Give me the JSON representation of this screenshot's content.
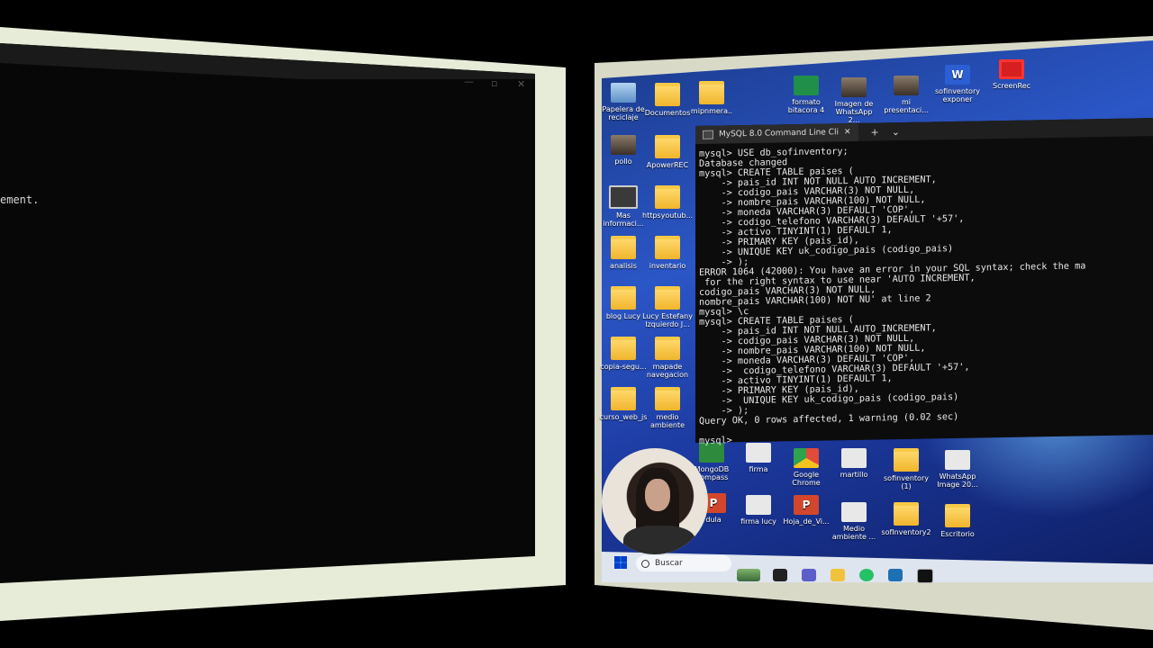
{
  "left_window": {
    "visible_text": "ement."
  },
  "desktop": {
    "icons": [
      {
        "label": "Papelera de reciclaje",
        "type": "bin"
      },
      {
        "label": "Documentos",
        "type": "folder"
      },
      {
        "label": "mipnmera..",
        "type": "folder"
      },
      {
        "label": "formato bitacora 4",
        "type": "sheet"
      },
      {
        "label": "Imagen de WhatsApp 2...",
        "type": "photo"
      },
      {
        "label": "mi presentaci...",
        "type": "photo"
      },
      {
        "label": "sofinventory exponer",
        "type": "word"
      },
      {
        "label": "ScreenRec",
        "type": "rec"
      },
      {
        "label": "pollo",
        "type": "photo"
      },
      {
        "label": "ApowerREC",
        "type": "folder"
      },
      {
        "label": "Mas informaci...",
        "type": "gear"
      },
      {
        "label": "httpsyoutub...",
        "type": "folder"
      },
      {
        "label": "analisis",
        "type": "folder"
      },
      {
        "label": "inventario",
        "type": "folder"
      },
      {
        "label": "blog Lucy",
        "type": "folder"
      },
      {
        "label": "Lucy Estefany Izquierdo J...",
        "type": "folder"
      },
      {
        "label": "copia-segu...",
        "type": "folder"
      },
      {
        "label": "mapade navegacion",
        "type": "folder"
      },
      {
        "label": "curso_web_js",
        "type": "folder"
      },
      {
        "label": "medio ambiente",
        "type": "folder"
      },
      {
        "label": "MongoDB Compass",
        "type": "mongo"
      },
      {
        "label": "firma",
        "type": "doc"
      },
      {
        "label": "Google Chrome",
        "type": "chrome"
      },
      {
        "label": "martillo",
        "type": "doc"
      },
      {
        "label": "sofinventory (1)",
        "type": "folder"
      },
      {
        "label": "WhatsApp Image 20...",
        "type": "doc"
      },
      {
        "label": "dula",
        "type": "ppt"
      },
      {
        "label": "firma lucy",
        "type": "doc"
      },
      {
        "label": "Hoja_de_Vi...",
        "type": "ppt"
      },
      {
        "label": "Medio ambiente ...",
        "type": "doc"
      },
      {
        "label": "sofInventory2",
        "type": "folder"
      },
      {
        "label": "Escritorio",
        "type": "folder"
      }
    ]
  },
  "terminal": {
    "tab_title": "MySQL 8.0 Command Line Cli",
    "close_glyph": "✕",
    "plus_glyph": "+",
    "chevron_glyph": "⌄",
    "lines": [
      "mysql> USE db_sofinventory;",
      "Database changed",
      "mysql> CREATE TABLE paises (",
      "    -> pais_id INT NOT NULL AUTO INCREMENT,",
      "    -> codigo_pais VARCHAR(3) NOT NULL,",
      "    -> nombre_pais VARCHAR(100) NOT NULL,",
      "    -> moneda VARCHAR(3) DEFAULT 'COP',",
      "    -> codigo_telefono VARCHAR(3) DEFAULT '+57',",
      "    -> activo TINYINT(1) DEFAULT 1,",
      "    -> PRIMARY KEY (pais_id),",
      "    -> UNIQUE KEY uk_codigo_pais (codigo_pais)",
      "    -> );",
      "ERROR 1064 (42000): You have an error in your SQL syntax; check the ma",
      " for the right syntax to use near 'AUTO INCREMENT,",
      "codigo_pais VARCHAR(3) NOT NULL,",
      "nombre_pais VARCHAR(100) NOT NU' at line 2",
      "mysql> \\c",
      "mysql> CREATE TABLE paises (",
      "    -> pais_id INT NOT NULL AUTO_INCREMENT,",
      "    -> codigo_pais VARCHAR(3) NOT NULL,",
      "    -> nombre_pais VARCHAR(100) NOT NULL,",
      "    -> moneda VARCHAR(3) DEFAULT 'COP',",
      "    ->  codigo_telefono VARCHAR(3) DEFAULT '+57',",
      "    -> activo TINYINT(1) DEFAULT 1,",
      "    -> PRIMARY KEY (pais_id),",
      "    ->  UNIQUE KEY uk_codigo_pais (codigo_pais)",
      "    -> );",
      "Query OK, 0 rows affected, 1 warning (0.02 sec)",
      "",
      "mysql>"
    ]
  },
  "taskbar": {
    "search_placeholder": "Buscar"
  }
}
